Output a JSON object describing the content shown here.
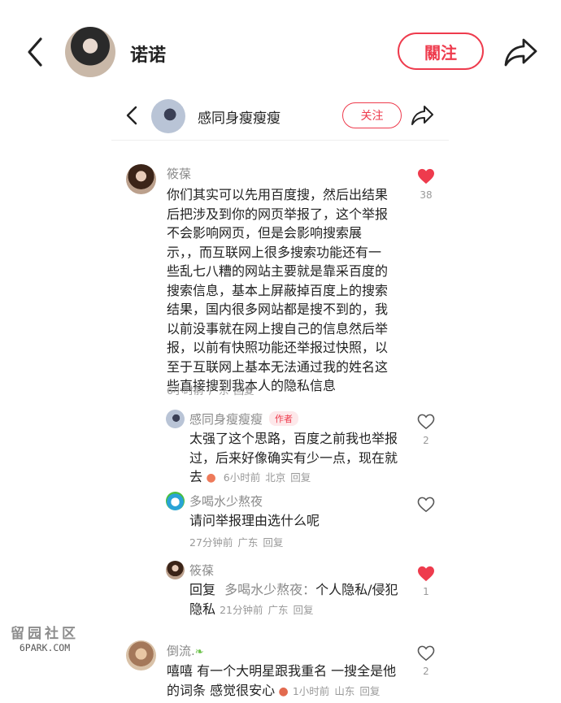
{
  "header": {
    "name": "诺诺",
    "follow_label": "關注"
  },
  "sub_header": {
    "name": "感同身瘦瘦瘦",
    "follow_label": "关注"
  },
  "comments": [
    {
      "user": "筱葆",
      "text": "你们其实可以先用百度搜，然后出结果后把涉及到你的网页举报了，这个举报不会影响网页，但是会影响搜索展示，，而互联网上很多搜索功能还有一些乱七八糟的网站主要就是靠采百度的搜索信息，基本上屏蔽掉百度上的搜索结果，国内很多网站都是搜不到的，我以前没事就在网上搜自己的信息然后举报，以前有快照功能还举报过快照，以至于互联网上基本无法通过我的姓名这些直接搜到我本人的隐私信息",
      "time": "6小时前",
      "location": "广东",
      "reply": "回复",
      "likes": "38",
      "liked": true
    },
    {
      "user": "感同身瘦瘦瘦",
      "badge": "作者",
      "text": "太强了这个思路，百度之前我也举报过，后来好像确实有少一点，现在就去",
      "time": "6小时前",
      "location": "北京",
      "reply": "回复",
      "likes": "2",
      "liked": false
    },
    {
      "user": "多喝水少熬夜",
      "text": "请问举报理由选什么呢",
      "time": "27分钟前",
      "location": "广东",
      "reply": "回复",
      "likes": "",
      "liked": false
    },
    {
      "user": "筱葆",
      "reply_prefix": "回复",
      "reply_to": "多喝水少熬夜：",
      "text": "个人隐私/侵犯隐私",
      "time": "21分钟前",
      "location": "广东",
      "reply": "回复",
      "likes": "1",
      "liked": true
    },
    {
      "user": "倒流.",
      "text": "嘻嘻 有一个大明星跟我重名 一搜全是他的词条 感觉很安心",
      "time": "1小时前",
      "location": "山东",
      "reply": "回复",
      "likes": "2",
      "liked": false
    }
  ],
  "watermark": {
    "line1": "留园社区",
    "line2": "6PARK.COM"
  },
  "colors": {
    "accent": "#ee3b4d",
    "meta": "#999999"
  }
}
